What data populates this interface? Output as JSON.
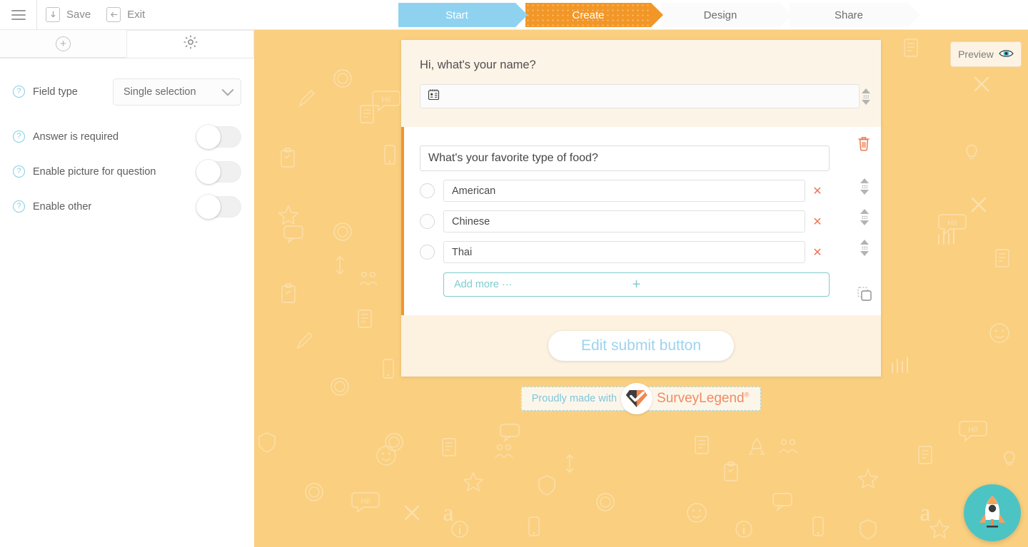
{
  "toolbar": {
    "menu_icon": "hamburger-icon",
    "save_label": "Save",
    "save_icon": "save-download-icon",
    "exit_label": "Exit",
    "exit_icon": "exit-arrow-icon"
  },
  "steps": [
    {
      "label": "Start",
      "state": "done",
      "color": "#8ed2f0"
    },
    {
      "label": "Create",
      "state": "active",
      "color": "#f29727"
    },
    {
      "label": "Design",
      "state": "upcoming",
      "color": "#fbfbfb"
    },
    {
      "label": "Share",
      "state": "upcoming",
      "color": "#fbfbfb"
    }
  ],
  "sidebar": {
    "tabs": [
      {
        "name": "add-question-tab",
        "icon": "plus-circle-icon",
        "active": false
      },
      {
        "name": "settings-tab",
        "icon": "gear-icon",
        "active": true
      }
    ],
    "settings": [
      {
        "label": "Field type",
        "control": "select",
        "value": "Single selection"
      },
      {
        "label": "Answer is required",
        "control": "toggle",
        "value": "off"
      },
      {
        "label": "Enable picture for question",
        "control": "toggle",
        "value": "off"
      },
      {
        "label": "Enable other",
        "control": "toggle",
        "value": "off"
      }
    ],
    "help_icon": "question-mark-icon"
  },
  "canvas": {
    "background_color": "#facf80",
    "preview": {
      "label": "Preview",
      "icon": "eye-icon"
    }
  },
  "survey": {
    "questions": [
      {
        "title": "Hi, what's your name?",
        "type": "name",
        "field_icon": "contact-card-icon",
        "value": "",
        "active": false
      },
      {
        "title": "What's your favorite type of food?",
        "type": "single-selection",
        "active": true,
        "options": [
          "American",
          "Chinese",
          "Thai"
        ],
        "add_more_label": "Add more ···",
        "add_more_icon": "plus-icon",
        "delete_icon": "trash-icon",
        "duplicate_icon": "copy-icon",
        "option_delete_icon": "x-icon",
        "reorder_icon": "up-down-arrows-icon"
      }
    ],
    "submit": {
      "label": "Edit submit button"
    }
  },
  "footer": {
    "badge_prefix": "Proudly made with",
    "brand": "SurveyLegend",
    "brand_mark": "®",
    "logo_icon": "surveylegend-diamond-check-icon"
  },
  "fab": {
    "icon": "rocket-icon",
    "color": "#4cc4c4"
  }
}
